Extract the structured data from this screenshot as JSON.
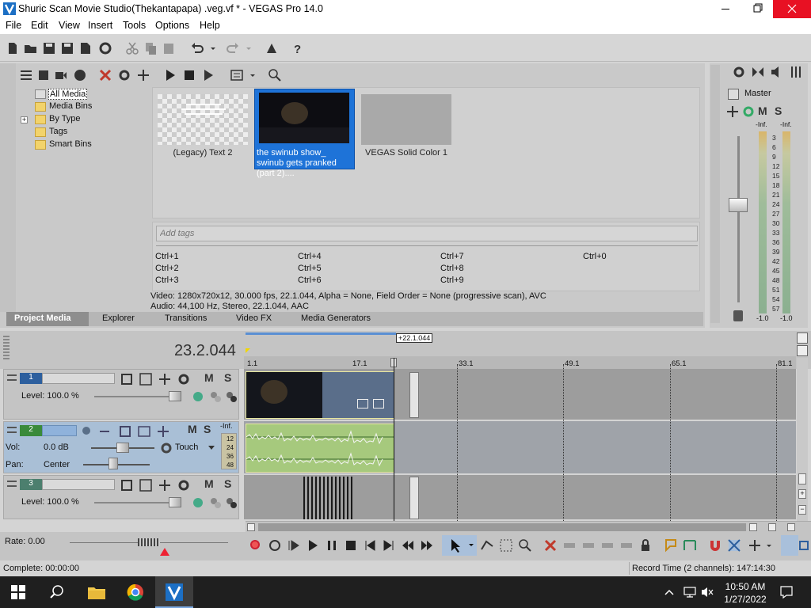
{
  "window": {
    "title": "Shuric Scan Movie Studio(Thekantapapa) .veg.vf * - VEGAS Pro 14.0"
  },
  "menu": [
    "File",
    "Edit",
    "View",
    "Insert",
    "Tools",
    "Options",
    "Help"
  ],
  "project_media": {
    "tree": [
      "All Media",
      "Media Bins",
      "By Type",
      "Tags",
      "Smart Bins"
    ],
    "items": [
      {
        "label": "(Legacy) Text 2",
        "selected": false
      },
      {
        "label": "the swinub show_ swinub gets pranked (part 2)....",
        "selected": true
      },
      {
        "label": "VEGAS Solid Color 1",
        "selected": false
      }
    ],
    "tags_placeholder": "Add tags",
    "shortcuts": [
      "Ctrl+1",
      "Ctrl+4",
      "Ctrl+7",
      "Ctrl+0",
      "Ctrl+2",
      "Ctrl+5",
      "Ctrl+8",
      "Ctrl+3",
      "Ctrl+6",
      "Ctrl+9"
    ],
    "info_video": "Video: 1280x720x12, 30.000 fps, 22.1.044, Alpha = None, Field Order = None (progressive scan), AVC",
    "info_audio": "Audio: 44,100 Hz, Stereo, 22.1.044, AAC",
    "tabs": [
      "Project Media",
      "Explorer",
      "Transitions",
      "Video FX",
      "Media Generators"
    ],
    "active_tab": "Project Media"
  },
  "master": {
    "label": "Master",
    "m": "M",
    "s": "S",
    "inf_left": "-Inf.",
    "inf_right": "-Inf.",
    "scale": [
      "3",
      "6",
      "9",
      "12",
      "15",
      "18",
      "21",
      "24",
      "27",
      "30",
      "33",
      "36",
      "39",
      "42",
      "45",
      "48",
      "51",
      "54",
      "57"
    ],
    "bottom_left": "-1.0",
    "bottom_right": "-1.0"
  },
  "timeline": {
    "time": "23.2.044",
    "marker": "+22.1.044",
    "ruler": [
      "1.1",
      "17.1",
      "33.1",
      "49.1",
      "65.1",
      "81.1"
    ]
  },
  "tracks": [
    {
      "number": "1",
      "level": "Level: 100.0 %",
      "m": "M",
      "s": "S"
    },
    {
      "number": "2",
      "vol_label": "Vol:",
      "vol_value": "0.0 dB",
      "pan_label": "Pan:",
      "pan_value": "Center",
      "mode": "Touch",
      "m": "M",
      "s": "S",
      "inf": "-Inf.",
      "meter": [
        "12",
        "24",
        "36",
        "48"
      ]
    },
    {
      "number": "3",
      "level": "Level: 100.0 %",
      "m": "M",
      "s": "S"
    }
  ],
  "rate": "Rate: 0.00",
  "status": {
    "left": "Complete: 00:00:00",
    "right": "Record Time (2 channels): 147:14:30"
  },
  "taskbar": {
    "time": "10:50 AM",
    "date": "1/27/2022"
  }
}
